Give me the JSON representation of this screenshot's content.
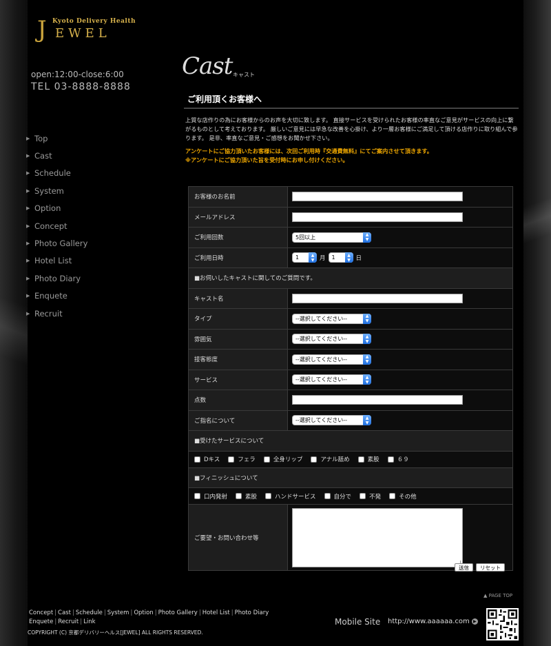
{
  "brand": {
    "initial": "J",
    "subtitle": "Kyoto Delivery Health",
    "name": "EWEL"
  },
  "hours": "open:12:00-close:6:00",
  "tel": "TEL  03-8888-8888",
  "nav": [
    "Top",
    "Cast",
    "Schedule",
    "System",
    "Option",
    "Concept",
    "Photo Gallery",
    "Hotel List",
    "Photo Diary",
    "Enquete",
    "Recruit"
  ],
  "page": {
    "title": "Cast",
    "subtitle": "キャスト",
    "section": "ご利用頂くお客様へ"
  },
  "intro": "上質な店作りの為にお客様からのお声を大切に致します。 直接サービスを受けられたお客様の率直なご意見がサービスの向上に繋がるものとして考えております。 厳しいご意見には早急な改善を心掛け、より一層お客様にご満足して頂ける店作りに取り組んで参ります。 是非、率直なご意見・ご感想をお聞かせ下さい。",
  "notice1": "アンケートにご協力頂いたお客様には、次回ご利用時『交通費無料』にてご案内させて頂きます。",
  "notice2": "※アンケートにご協力頂いた旨を受付時にお申し付けください。",
  "form": {
    "name_label": "お客様のお名前",
    "email_label": "メールアドレス",
    "visits_label": "ご利用回数",
    "visits_value": "5回以上",
    "date_label": "ご利用日時",
    "month_value": "1",
    "month_unit": "月",
    "day_value": "1",
    "day_unit": "日",
    "cast_section": "■お伺いしたキャストに関してのご質問です。",
    "cast_name_label": "キャスト名",
    "select_placeholder": "--選択してください--",
    "type_label": "タイプ",
    "mood_label": "雰囲気",
    "attitude_label": "接客態度",
    "service_label": "サービス",
    "score_label": "点数",
    "nomination_label": "ご指名について",
    "services_section": "■受けたサービスについて",
    "services": [
      "Dキス",
      "フェラ",
      "全身リップ",
      "アナル舐め",
      "素股",
      "６９"
    ],
    "finish_section": "■フィニッシュについて",
    "finish": [
      "口内発射",
      "素股",
      "ハンドサービス",
      "自分で",
      "不発",
      "その他"
    ],
    "request_label": "ご要望・お問い合わせ等",
    "submit": "送信",
    "reset": "リセット"
  },
  "pagetop": "▲ PAGE TOP",
  "footer_links": [
    "Concept",
    "Cast",
    "Schedule",
    "System",
    "Option",
    "Photo Gallery",
    "Hotel List",
    "Photo Diary",
    "Enquete",
    "Recruit",
    "Link"
  ],
  "copyright": "COPYRIGHT (C) 京都デリバリーヘルス[JEWEL] ALL RIGHTS RESERVED.",
  "mobile_label": "Mobile Site",
  "mobile_url": "http://www.aaaaaa.com",
  "colors": {
    "accent_gold": "#d7b24c",
    "notice": "#f0a800",
    "select_knob": "#1f6fe0"
  },
  "icons": {
    "nav_arrow": "triangle-right-icon",
    "select": "updown-arrows-icon",
    "mobile_go": "circle-arrow-icon",
    "qr": "qr-code-icon"
  }
}
